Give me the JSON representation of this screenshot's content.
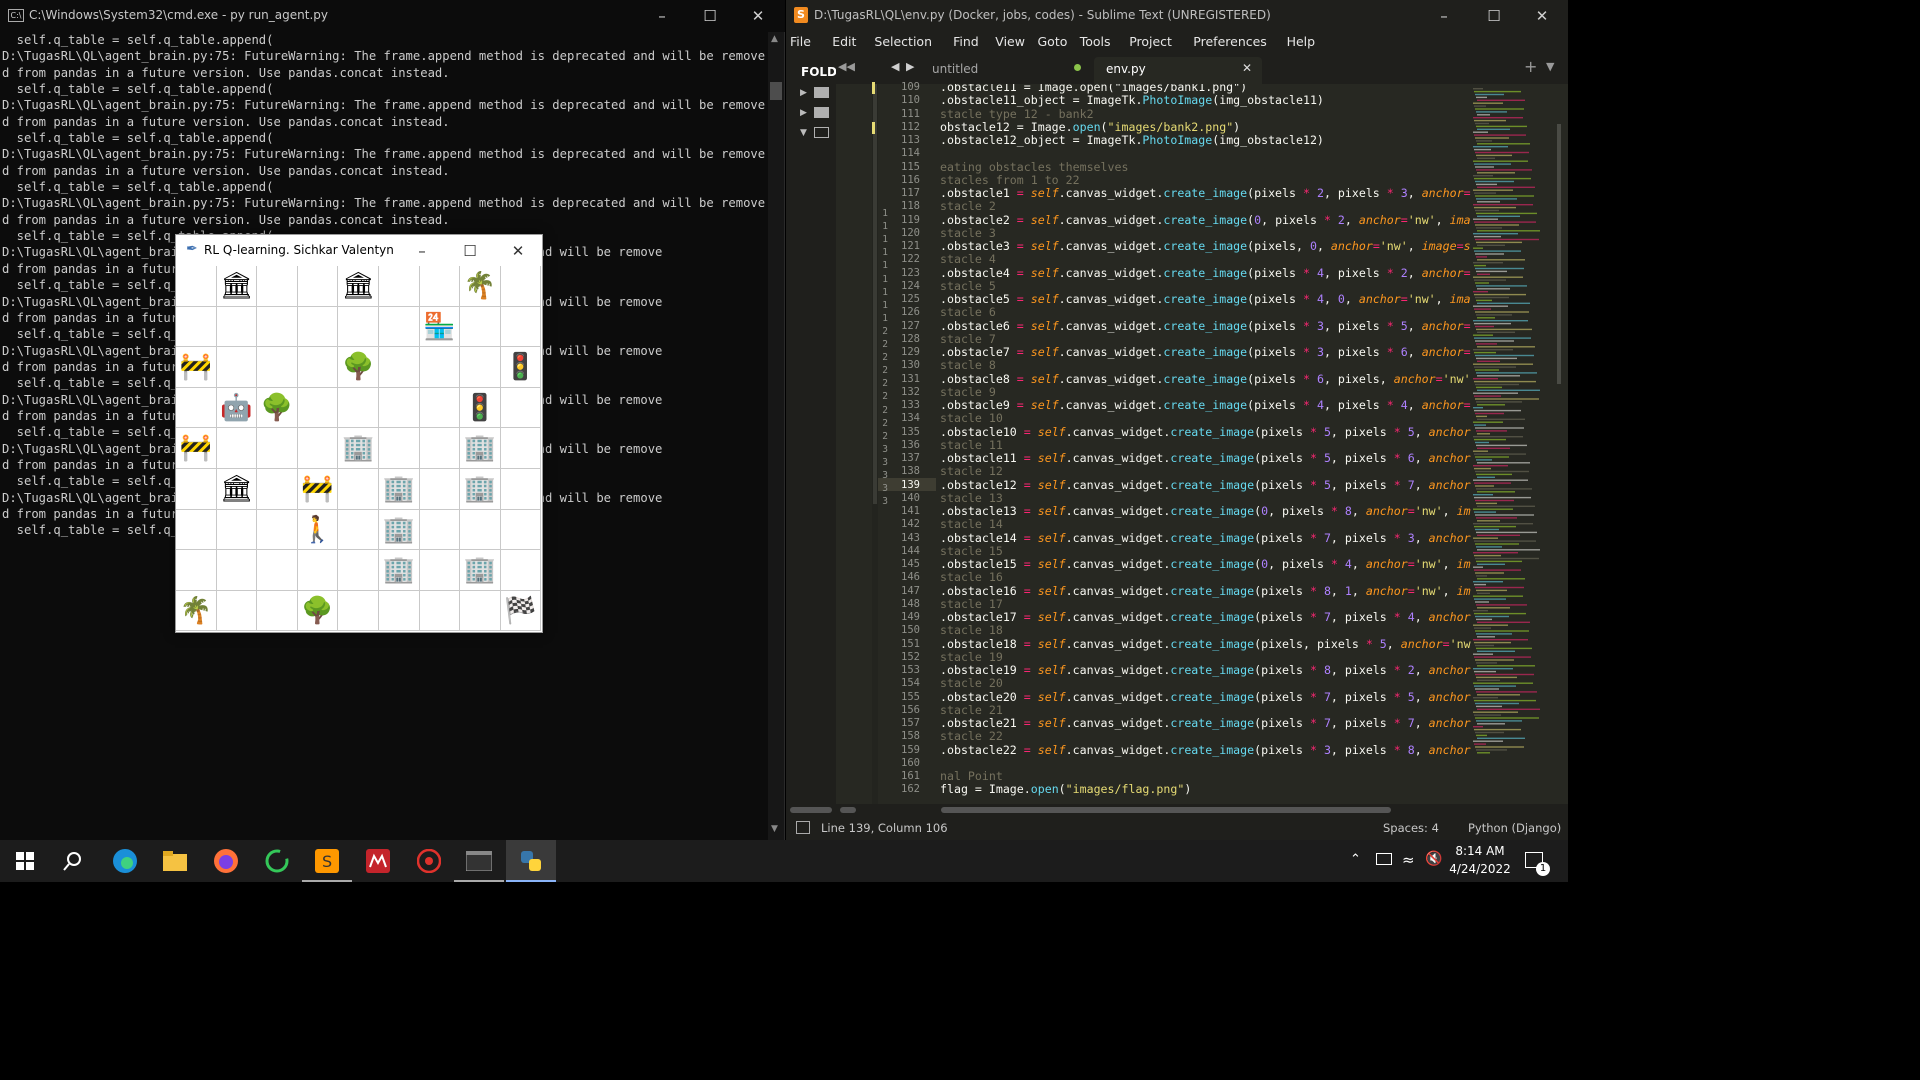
{
  "cmd": {
    "title": "C:\\Windows\\System32\\cmd.exe - py  run_agent.py",
    "lines": [
      "  self.q_table = self.q_table.append(",
      "D:\\TugasRL\\QL\\agent_brain.py:75: FutureWarning: The frame.append method is deprecated and will be remove",
      "d from pandas in a future version. Use pandas.concat instead.",
      "  self.q_table = self.q_table.append(",
      "D:\\TugasRL\\QL\\agent_brain.py:75: FutureWarning: The frame.append method is deprecated and will be remove",
      "d from pandas in a future version. Use pandas.concat instead.",
      "  self.q_table = self.q_table.append(",
      "D:\\TugasRL\\QL\\agent_brain.py:75: FutureWarning: The frame.append method is deprecated and will be remove",
      "d from pandas in a future version. Use pandas.concat instead.",
      "  self.q_table = self.q_table.append(",
      "D:\\TugasRL\\QL\\agent_brain.py:75: FutureWarning: The frame.append method is deprecated and will be remove",
      "d from pandas in a future version. Use pandas.concat instead.",
      "  self.q_table = self.q_table.append(",
      "D:\\TugasRL\\QL\\agent_brai                                     deprecated and will be remove",
      "d from pandas in a futur",
      "  self.q_table = self.q_",
      "D:\\TugasRL\\QL\\agent_brai                                     deprecated and will be remove",
      "d from pandas in a futur",
      "  self.q_table = self.q_",
      "D:\\TugasRL\\QL\\agent_brai                                     deprecated and will be remove",
      "d from pandas in a futur",
      "  self.q_table = self.q_",
      "D:\\TugasRL\\QL\\agent_brai                                     deprecated and will be remove",
      "d from pandas in a futur",
      "  self.q_table = self.q_",
      "D:\\TugasRL\\QL\\agent_brai                                     deprecated and will be remove",
      "d from pandas in a futur",
      "  self.q_table = self.q_",
      "D:\\TugasRL\\QL\\agent_brai                                     deprecated and will be remove",
      "d from pandas in a futur",
      "  self.q_table = self.q_"
    ]
  },
  "tk": {
    "title": "RL Q-learning. Sichkar Valentyn",
    "grid": [
      [
        "",
        "🏛",
        "",
        "",
        "🏛",
        "",
        "",
        "🌴",
        ""
      ],
      [
        "",
        "",
        "",
        "",
        "",
        "",
        "🏪",
        "",
        ""
      ],
      [
        "🚧",
        "",
        "",
        "",
        "🌳",
        "",
        "",
        "",
        "🚦"
      ],
      [
        "",
        "🤖",
        "🌳",
        "",
        "",
        "",
        "",
        "🚦",
        ""
      ],
      [
        "🚧",
        "",
        "",
        "",
        "🏢",
        "",
        "",
        "🏢",
        ""
      ],
      [
        "",
        "🏛",
        "",
        "🚧",
        "",
        "🏢",
        "",
        "🏢",
        ""
      ],
      [
        "",
        "",
        "",
        "🚶",
        "",
        "🏢",
        "",
        "",
        ""
      ],
      [
        "",
        "",
        "",
        "",
        "",
        "🏢",
        "",
        "🏢",
        ""
      ],
      [
        "🌴",
        "",
        "",
        "🌳",
        "",
        "",
        "",
        "",
        "🏁"
      ]
    ]
  },
  "sublime": {
    "title": "D:\\TugasRL\\QL\\env.py (Docker, jobs, codes) - Sublime Text (UNREGISTERED)",
    "menu": [
      "File",
      "Edit",
      "Selection",
      "Find",
      "View",
      "Goto",
      "Tools",
      "Project",
      "Preferences",
      "Help"
    ],
    "sidebar_label": "FOLD",
    "tabs": [
      {
        "label": "untitled",
        "active": false
      },
      {
        "label": "env.py",
        "active": true
      }
    ],
    "status": {
      "position": "Line 139, Column 106",
      "spaces": "Spaces: 4",
      "syntax": "Python (Django)"
    },
    "gutter_numbers": [
      "1",
      "1",
      "1",
      "1",
      "1",
      "1",
      "1",
      "1",
      "1",
      "2",
      "2",
      "2",
      "2",
      "2",
      "2",
      "2",
      "2",
      "2",
      "3",
      "3",
      "3",
      "3",
      "3"
    ],
    "code": [
      {
        "n": "109",
        "html": ".obstacle11 = Image.open(\"images/bank1.png\")"
      },
      {
        "n": "110",
        "html": ".obstacle11_object = ImageTk.<span class=\"fn\">PhotoImage</span>(img_obstacle11)"
      },
      {
        "n": "111",
        "html": "<span class=\"cm\">stacle type 12 - bank2</span>"
      },
      {
        "n": "112",
        "html": "obstacle12 = Image.<span class=\"fn\">open</span>(<span class=\"str\">\"images/bank2.png\"</span>)"
      },
      {
        "n": "113",
        "html": ".obstacle12_object = ImageTk.<span class=\"fn\">PhotoImage</span>(img_obstacle12)"
      },
      {
        "n": "114",
        "html": ""
      },
      {
        "n": "115",
        "html": "<span class=\"cm\">eating obstacles themselves</span>"
      },
      {
        "n": "116",
        "html": "<span class=\"cm\">stacles from 1 to 22</span>"
      },
      {
        "n": "117",
        "html": ".obstacle1 <span class=\"op\">=</span> <span class=\"sf\">self</span>.canvas_widget.<span class=\"fn\">create_image</span>(pixels <span class=\"op\">*</span> <span class=\"num\">2</span>, pixels <span class=\"op\">*</span> <span class=\"num\">3</span>, <span class=\"kw\">anchor</span><span class=\"op\">=</span><span class=\"str\">'nw'</span>, <span class=\"kw\">imag</span>"
      },
      {
        "n": "118",
        "html": "<span class=\"cm\">stacle 2</span>"
      },
      {
        "n": "119",
        "html": ".obstacle2 <span class=\"op\">=</span> <span class=\"sf\">self</span>.canvas_widget.<span class=\"fn\">create_image</span>(<span class=\"num\">0</span>, pixels <span class=\"op\">*</span> <span class=\"num\">2</span>, <span class=\"kw\">anchor</span><span class=\"op\">=</span><span class=\"str\">'nw'</span>, <span class=\"kw\">image</span><span class=\"op\">=</span><span class=\"sf\">self</span>.ob"
      },
      {
        "n": "120",
        "html": "<span class=\"cm\">stacle 3</span>"
      },
      {
        "n": "121",
        "html": ".obstacle3 <span class=\"op\">=</span> <span class=\"sf\">self</span>.canvas_widget.<span class=\"fn\">create_image</span>(pixels, <span class=\"num\">0</span>, <span class=\"kw\">anchor</span><span class=\"op\">=</span><span class=\"str\">'nw'</span>, <span class=\"kw\">image</span><span class=\"op\">=</span><span class=\"sf\">self</span>.obstac"
      },
      {
        "n": "122",
        "html": "<span class=\"cm\">stacle 4</span>"
      },
      {
        "n": "123",
        "html": ".obstacle4 <span class=\"op\">=</span> <span class=\"sf\">self</span>.canvas_widget.<span class=\"fn\">create_image</span>(pixels <span class=\"op\">*</span> <span class=\"num\">4</span>, pixels <span class=\"op\">*</span> <span class=\"num\">2</span>, <span class=\"kw\">anchor</span><span class=\"op\">=</span><span class=\"str\">'nw'</span>, <span class=\"kw\">imag</span>"
      },
      {
        "n": "124",
        "html": "<span class=\"cm\">stacle 5</span>"
      },
      {
        "n": "125",
        "html": ".obstacle5 <span class=\"op\">=</span> <span class=\"sf\">self</span>.canvas_widget.<span class=\"fn\">create_image</span>(pixels <span class=\"op\">*</span> <span class=\"num\">4</span>, <span class=\"num\">0</span>, <span class=\"kw\">anchor</span><span class=\"op\">=</span><span class=\"str\">'nw'</span>, <span class=\"kw\">image</span><span class=\"op\">=</span><span class=\"sf\">self</span>.ob"
      },
      {
        "n": "126",
        "html": "<span class=\"cm\">stacle 6</span>"
      },
      {
        "n": "127",
        "html": ".obstacle6 <span class=\"op\">=</span> <span class=\"sf\">self</span>.canvas_widget.<span class=\"fn\">create_image</span>(pixels <span class=\"op\">*</span> <span class=\"num\">3</span>, pixels <span class=\"op\">*</span> <span class=\"num\">5</span>, <span class=\"kw\">anchor</span><span class=\"op\">=</span><span class=\"str\">'nw'</span>, <span class=\"kw\">imag</span>"
      },
      {
        "n": "128",
        "html": "<span class=\"cm\">stacle 7</span>"
      },
      {
        "n": "129",
        "html": ".obstacle7 <span class=\"op\">=</span> <span class=\"sf\">self</span>.canvas_widget.<span class=\"fn\">create_image</span>(pixels <span class=\"op\">*</span> <span class=\"num\">3</span>, pixels <span class=\"op\">*</span> <span class=\"num\">6</span>, <span class=\"kw\">anchor</span><span class=\"op\">=</span><span class=\"str\">'nw'</span>, <span class=\"kw\">imag</span>"
      },
      {
        "n": "130",
        "html": "<span class=\"cm\">stacle 8</span>"
      },
      {
        "n": "131",
        "html": ".obstacle8 <span class=\"op\">=</span> <span class=\"sf\">self</span>.canvas_widget.<span class=\"fn\">create_image</span>(pixels <span class=\"op\">*</span> <span class=\"num\">6</span>, pixels, <span class=\"kw\">anchor</span><span class=\"op\">=</span><span class=\"str\">'nw'</span>, <span class=\"kw\">image</span><span class=\"op\">=</span>se"
      },
      {
        "n": "132",
        "html": "<span class=\"cm\">stacle 9</span>"
      },
      {
        "n": "133",
        "html": ".obstacle9 <span class=\"op\">=</span> <span class=\"sf\">self</span>.canvas_widget.<span class=\"fn\">create_image</span>(pixels <span class=\"op\">*</span> <span class=\"num\">4</span>, pixels <span class=\"op\">*</span> <span class=\"num\">4</span>, <span class=\"kw\">anchor</span><span class=\"op\">=</span><span class=\"str\">'nw'</span>, <span class=\"kw\">imag</span>"
      },
      {
        "n": "134",
        "html": "<span class=\"cm\">stacle 10</span>"
      },
      {
        "n": "135",
        "html": ".obstacle10 <span class=\"op\">=</span> <span class=\"sf\">self</span>.canvas_widget.<span class=\"fn\">create_image</span>(pixels <span class=\"op\">*</span> <span class=\"num\">5</span>, pixels <span class=\"op\">*</span> <span class=\"num\">5</span>, <span class=\"kw\">anchor</span><span class=\"op\">=</span><span class=\"str\">'nw'</span>, <span class=\"kw\">ima</span>"
      },
      {
        "n": "136",
        "html": "<span class=\"cm\">stacle 11</span>"
      },
      {
        "n": "137",
        "html": ".obstacle11 <span class=\"op\">=</span> <span class=\"sf\">self</span>.canvas_widget.<span class=\"fn\">create_image</span>(pixels <span class=\"op\">*</span> <span class=\"num\">5</span>, pixels <span class=\"op\">*</span> <span class=\"num\">6</span>, <span class=\"kw\">anchor</span><span class=\"op\">=</span><span class=\"str\">'nw'</span>, <span class=\"kw\">ima</span>"
      },
      {
        "n": "138",
        "html": "<span class=\"cm\">stacle 12</span>"
      },
      {
        "n": "139",
        "html": ".obstacle12 <span class=\"op\">=</span> <span class=\"sf\">self</span>.canvas_widget.<span class=\"fn\">create_image</span>(pixels <span class=\"op\">*</span> <span class=\"num\">5</span>, pixels <span class=\"op\">*</span> <span class=\"num\">7</span>, <span class=\"kw\">anchor</span><span class=\"op\">=</span><span class=\"str\">'nw'</span>, <span class=\"kw\">ima</span>"
      },
      {
        "n": "140",
        "html": "<span class=\"cm\">stacle 13</span>"
      },
      {
        "n": "141",
        "html": ".obstacle13 <span class=\"op\">=</span> <span class=\"sf\">self</span>.canvas_widget.<span class=\"fn\">create_image</span>(<span class=\"num\">0</span>, pixels <span class=\"op\">*</span> <span class=\"num\">8</span>, <span class=\"kw\">anchor</span><span class=\"op\">=</span><span class=\"str\">'nw'</span>, <span class=\"kw\">image</span><span class=\"op\">=</span><span class=\"sf\">self</span>.o"
      },
      {
        "n": "142",
        "html": "<span class=\"cm\">stacle 14</span>"
      },
      {
        "n": "143",
        "html": ".obstacle14 <span class=\"op\">=</span> <span class=\"sf\">self</span>.canvas_widget.<span class=\"fn\">create_image</span>(pixels <span class=\"op\">*</span> <span class=\"num\">7</span>, pixels <span class=\"op\">*</span> <span class=\"num\">3</span>, <span class=\"kw\">anchor</span><span class=\"op\">=</span><span class=\"str\">'nw'</span>, <span class=\"kw\">ima</span>"
      },
      {
        "n": "144",
        "html": "<span class=\"cm\">stacle 15</span>"
      },
      {
        "n": "145",
        "html": ".obstacle15 <span class=\"op\">=</span> <span class=\"sf\">self</span>.canvas_widget.<span class=\"fn\">create_image</span>(<span class=\"num\">0</span>, pixels <span class=\"op\">*</span> <span class=\"num\">4</span>, <span class=\"kw\">anchor</span><span class=\"op\">=</span><span class=\"str\">'nw'</span>, <span class=\"kw\">image</span><span class=\"op\">=</span><span class=\"sf\">self</span>.o"
      },
      {
        "n": "146",
        "html": "<span class=\"cm\">stacle 16</span>"
      },
      {
        "n": "147",
        "html": ".obstacle16 <span class=\"op\">=</span> <span class=\"sf\">self</span>.canvas_widget.<span class=\"fn\">create_image</span>(pixels <span class=\"op\">*</span> <span class=\"num\">8</span>, <span class=\"num\">1</span>, <span class=\"kw\">anchor</span><span class=\"op\">=</span><span class=\"str\">'nw'</span>, <span class=\"kw\">image</span><span class=\"op\">=</span><span class=\"sf\">self</span>.o"
      },
      {
        "n": "148",
        "html": "<span class=\"cm\">stacle 17</span>"
      },
      {
        "n": "149",
        "html": ".obstacle17 <span class=\"op\">=</span> <span class=\"sf\">self</span>.canvas_widget.<span class=\"fn\">create_image</span>(pixels <span class=\"op\">*</span> <span class=\"num\">7</span>, pixels <span class=\"op\">*</span> <span class=\"num\">4</span>, <span class=\"kw\">anchor</span><span class=\"op\">=</span><span class=\"str\">'nw'</span>, <span class=\"kw\">ima</span>"
      },
      {
        "n": "150",
        "html": "<span class=\"cm\">stacle 18</span>"
      },
      {
        "n": "151",
        "html": ".obstacle18 <span class=\"op\">=</span> <span class=\"sf\">self</span>.canvas_widget.<span class=\"fn\">create_image</span>(pixels, pixels <span class=\"op\">*</span> <span class=\"num\">5</span>, <span class=\"kw\">anchor</span><span class=\"op\">=</span><span class=\"str\">'nw'</span>, <span class=\"kw\">image</span><span class=\"op\">=</span>s"
      },
      {
        "n": "152",
        "html": "<span class=\"cm\">stacle 19</span>"
      },
      {
        "n": "153",
        "html": ".obstacle19 <span class=\"op\">=</span> <span class=\"sf\">self</span>.canvas_widget.<span class=\"fn\">create_image</span>(pixels <span class=\"op\">*</span> <span class=\"num\">8</span>, pixels <span class=\"op\">*</span> <span class=\"num\">2</span>, <span class=\"kw\">anchor</span><span class=\"op\">=</span><span class=\"str\">'nw'</span>, <span class=\"kw\">ima</span>"
      },
      {
        "n": "154",
        "html": "<span class=\"cm\">stacle 20</span>"
      },
      {
        "n": "155",
        "html": ".obstacle20 <span class=\"op\">=</span> <span class=\"sf\">self</span>.canvas_widget.<span class=\"fn\">create_image</span>(pixels <span class=\"op\">*</span> <span class=\"num\">7</span>, pixels <span class=\"op\">*</span> <span class=\"num\">5</span>, <span class=\"kw\">anchor</span><span class=\"op\">=</span><span class=\"str\">'nw'</span>, <span class=\"kw\">ima</span>"
      },
      {
        "n": "156",
        "html": "<span class=\"cm\">stacle 21</span>"
      },
      {
        "n": "157",
        "html": ".obstacle21 <span class=\"op\">=</span> <span class=\"sf\">self</span>.canvas_widget.<span class=\"fn\">create_image</span>(pixels <span class=\"op\">*</span> <span class=\"num\">7</span>, pixels <span class=\"op\">*</span> <span class=\"num\">7</span>, <span class=\"kw\">anchor</span><span class=\"op\">=</span><span class=\"str\">'nw'</span>, <span class=\"kw\">ima</span>"
      },
      {
        "n": "158",
        "html": "<span class=\"cm\">stacle 22</span>"
      },
      {
        "n": "159",
        "html": ".obstacle22 <span class=\"op\">=</span> <span class=\"sf\">self</span>.canvas_widget.<span class=\"fn\">create_image</span>(pixels <span class=\"op\">*</span> <span class=\"num\">3</span>, pixels <span class=\"op\">*</span> <span class=\"num\">8</span>, <span class=\"kw\">anchor</span><span class=\"op\">=</span><span class=\"str\">'nw'</span>, <span class=\"kw\">ima</span>"
      },
      {
        "n": "160",
        "html": ""
      },
      {
        "n": "161",
        "html": "<span class=\"cm\">nal Point</span>"
      },
      {
        "n": "162",
        "html": "flag = Image.<span class=\"fn\">open</span>(<span class=\"str\">\"images/flag.png\"</span>)"
      }
    ]
  },
  "taskbar": {
    "clock_time": "8:14 AM",
    "clock_date": "4/24/2022",
    "notif_count": "1"
  }
}
